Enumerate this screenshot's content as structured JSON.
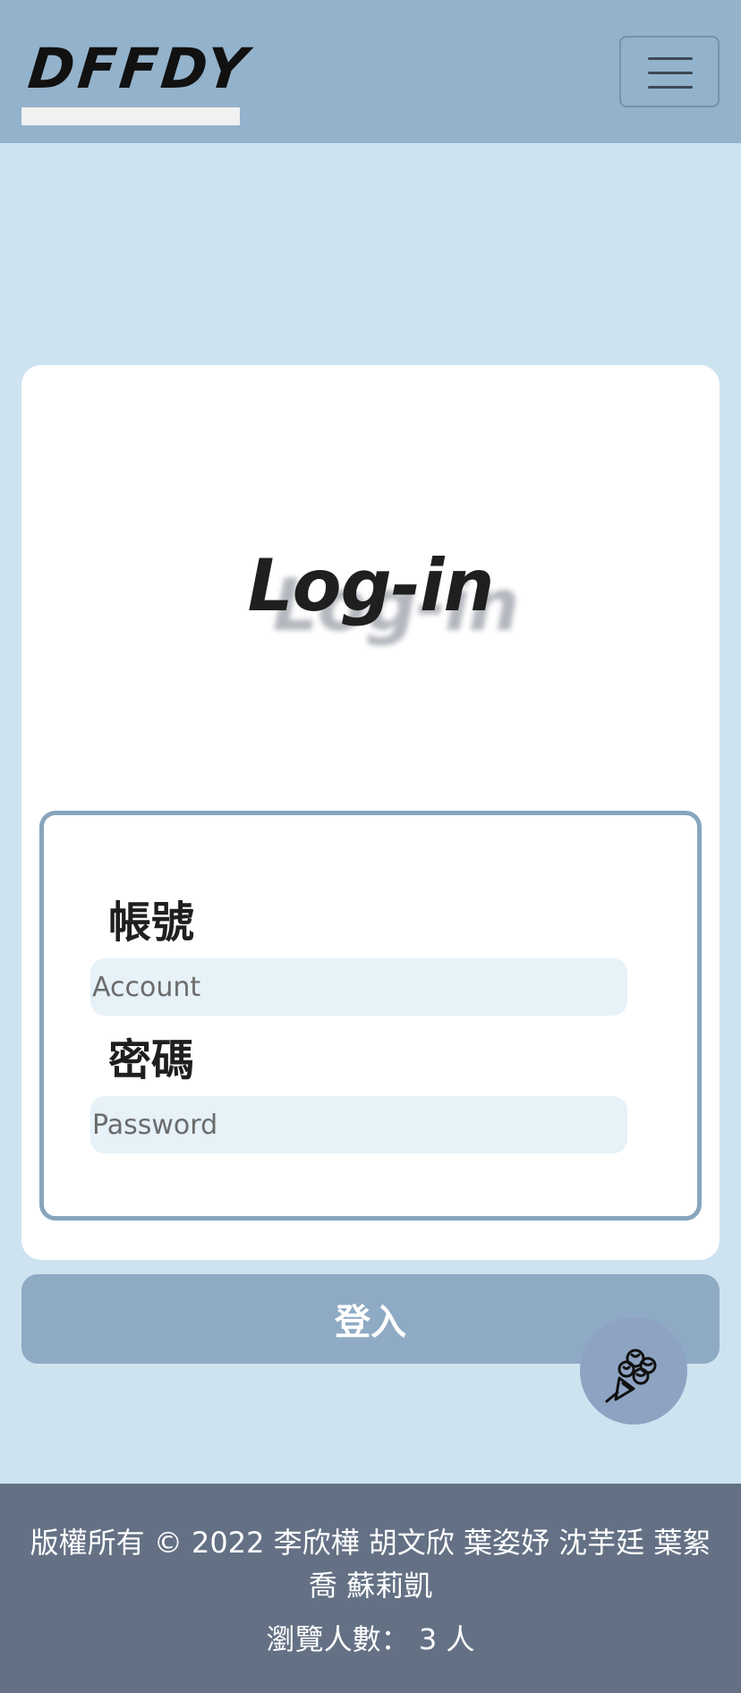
{
  "navbar": {
    "brand": "DFFDY",
    "toggle_icon": "hamburger-menu-icon"
  },
  "login": {
    "title": "Log-in",
    "account_label": "帳號",
    "account_placeholder": "Account",
    "password_label": "密碼",
    "password_placeholder": "Password",
    "submit_label": "登入",
    "floating_icon": "flower-bouquet-icon"
  },
  "footer": {
    "copyright": "版權所有 © 2022 李欣樺 胡文欣 葉姿妤 沈芋廷 葉絮喬 蘇莉凱",
    "views": "瀏覽人數： 3 人"
  },
  "colors": {
    "navbar_bg": "#93b2cb",
    "page_bg": "#cde3f0",
    "button_bg": "#8faac4",
    "footer_bg": "#647185"
  }
}
